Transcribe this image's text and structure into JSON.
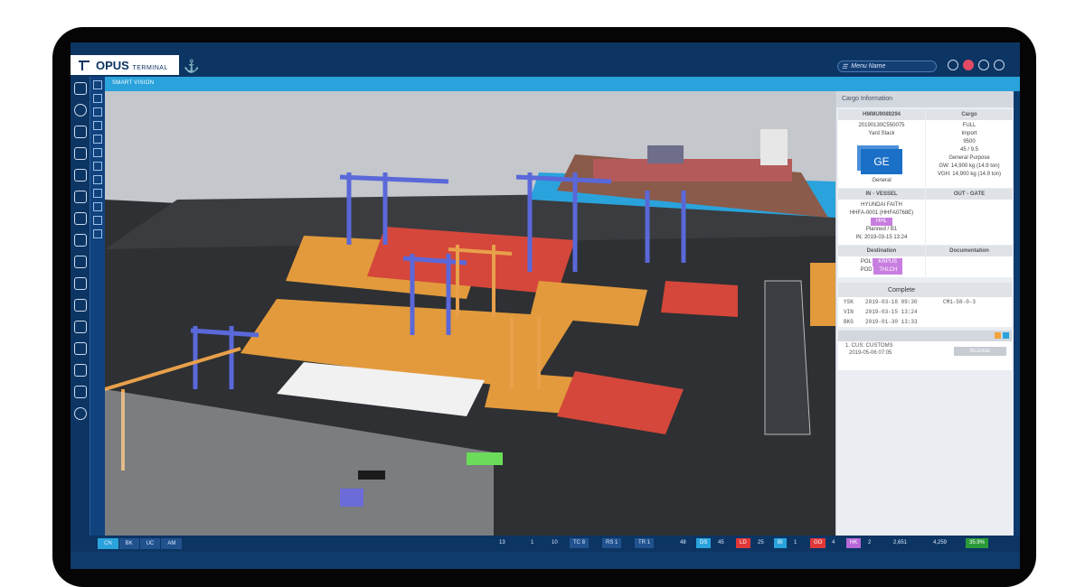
{
  "app": {
    "brand": "OPUS",
    "brand_sub": "TERMINAL"
  },
  "topbar": {
    "menu_name": "Menu Name"
  },
  "view": {
    "title": "SMART VISION"
  },
  "cargo": {
    "panel_title": "Cargo Information",
    "container_id": "HMMU9089294",
    "booking_ref": "20190130C550075",
    "location": "Yard Stack",
    "hazard_badge": "",
    "type_code": "GE",
    "type_label": "General",
    "cargo_header": "Cargo",
    "cargo_lines": [
      "FULL",
      "Import",
      "9500",
      "45 / 9.5",
      "General Purpose",
      "GW: 14,900 kg (14.9 ton)",
      "VGH: 14,900 kg (14.9 ton)"
    ],
    "in_header": "IN - VESSEL",
    "in_lines": [
      "HYUNDAI FAITH",
      "HHFA-0001 (HHFA0768E)"
    ],
    "in_badge": "HHL",
    "in_lines2": [
      "Planned / B1",
      "IN: 2019-03-15 13:24"
    ],
    "out_header": "OUT - GATE",
    "dest_header": "Destination",
    "pol_label": "POL",
    "pol_value": "KRPUS",
    "pod_label": "POD",
    "pod_value": "THLCH",
    "doc_header": "Documentation"
  },
  "complete": {
    "header": "Complete",
    "rows": [
      {
        "code": "YSK",
        "time": "2019-03-18 09:30",
        "ref": "CM1-58-0-3"
      },
      {
        "code": "VIN",
        "time": "2019-03-15 13:24",
        "ref": ""
      },
      {
        "code": "BKG",
        "time": "2019-01-30 13:33",
        "ref": ""
      }
    ]
  },
  "customs": {
    "line1": "1. CUS: CUSTOMS",
    "line2": "2019-05-06 07:05",
    "button": "RELEASE"
  },
  "bottom": {
    "tabs": [
      "CN",
      "BK",
      "UC",
      "AM"
    ],
    "stats": [
      "13",
      "1",
      "10",
      "TC 8",
      "RS 1",
      "TR 1",
      "48",
      "DS",
      "45",
      "LD",
      "25",
      "BI",
      "1",
      "GO",
      "4",
      "HK",
      "2",
      "2,651",
      "4,259",
      "35.9%"
    ]
  },
  "colors": {
    "accent": "#2aa3dc",
    "navy": "#0c3563",
    "container_orange": "#e8a04a",
    "crane_blue": "#5a68d9"
  }
}
